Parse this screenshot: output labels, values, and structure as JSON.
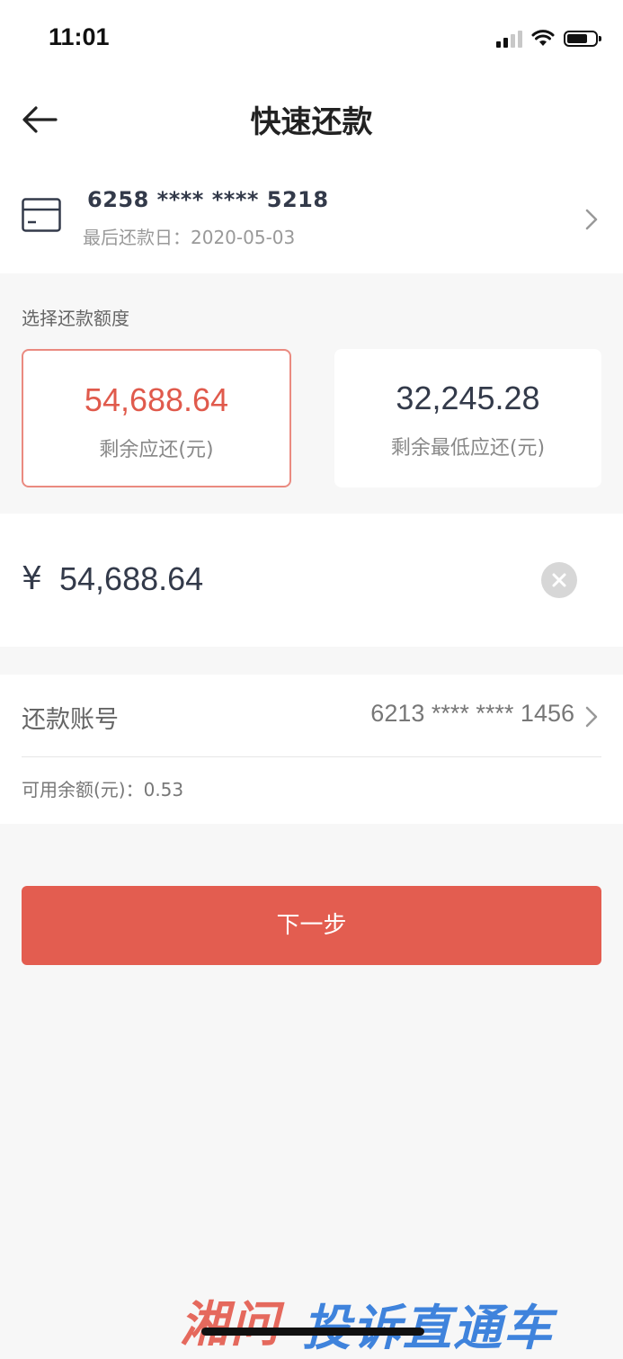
{
  "status_bar": {
    "time": "11:01"
  },
  "nav": {
    "title": "快速还款"
  },
  "card": {
    "number": "6258 **** **** 5218",
    "last_due_date": "最后还款日：2020-05-03"
  },
  "repay_amount": {
    "section_label": "选择还款额度",
    "options": [
      {
        "value": "54,688.64",
        "label": "剩余应还(元)",
        "selected": true
      },
      {
        "value": "32,245.28",
        "label": "剩余最低应还(元)",
        "selected": false
      }
    ]
  },
  "amount_input": {
    "currency_symbol": "¥",
    "value": "54,688.64"
  },
  "account": {
    "label": "还款账号",
    "value": "6213 **** **** 1456",
    "balance_text": "可用余额(元)：0.53"
  },
  "next_button": {
    "label": "下一步"
  },
  "watermark": {
    "text_1": "湘问",
    "text_2": "投诉直通车"
  },
  "colors": {
    "accent": "#e35d50",
    "selected_text": "#e05a4c",
    "dark_text": "#333a4a"
  }
}
